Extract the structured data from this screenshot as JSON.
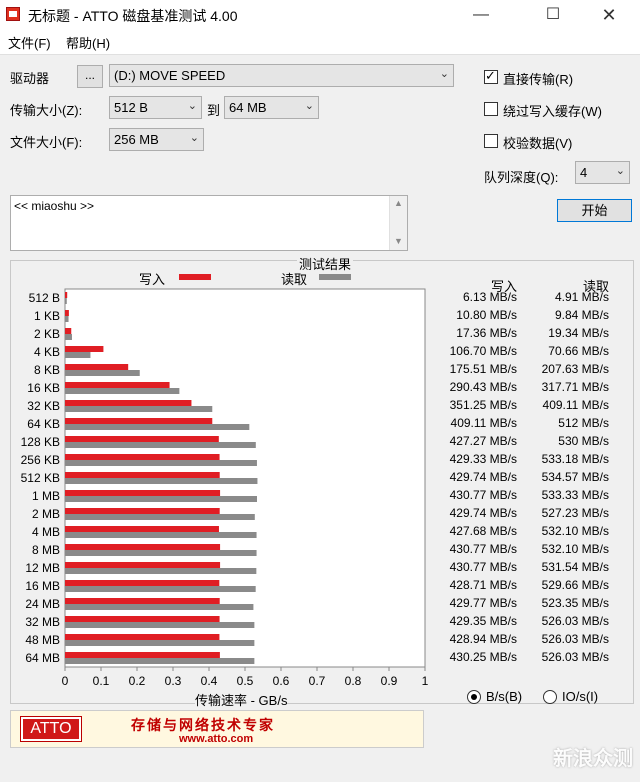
{
  "window": {
    "title": "无标题 - ATTO 磁盘基准测试 4.00"
  },
  "menu": {
    "file": "文件(F)",
    "help": "帮助(H)"
  },
  "settings": {
    "drive_label": "驱动器",
    "drive_browse": "...",
    "drive_value": "(D:) MOVE SPEED",
    "transfer_label": "传输大小(Z):",
    "transfer_from": "512 B",
    "to_label": "到",
    "transfer_to": "64 MB",
    "file_size_label": "文件大小(F):",
    "file_size": "256 MB",
    "direct_io_label": "直接传输(R)",
    "direct_io_checked": true,
    "bypass_cache_label": "绕过写入缓存(W)",
    "bypass_cache_checked": false,
    "verify_label": "校验数据(V)",
    "verify_checked": false,
    "queue_label": "队列深度(Q):",
    "queue_value": "4",
    "start_label": "开始"
  },
  "log": {
    "text": "<< miaoshu >>"
  },
  "results": {
    "title": "测试结果",
    "write_legend": "写入",
    "read_legend": "读取",
    "col_write": "写入",
    "col_read": "读取",
    "rows": [
      {
        "size": "512 B",
        "write": "6.13 MB/s",
        "read": "4.91 MB/s"
      },
      {
        "size": "1 KB",
        "write": "10.80 MB/s",
        "read": "9.84 MB/s"
      },
      {
        "size": "2 KB",
        "write": "17.36 MB/s",
        "read": "19.34 MB/s"
      },
      {
        "size": "4 KB",
        "write": "106.70 MB/s",
        "read": "70.66 MB/s"
      },
      {
        "size": "8 KB",
        "write": "175.51 MB/s",
        "read": "207.63 MB/s"
      },
      {
        "size": "16 KB",
        "write": "290.43 MB/s",
        "read": "317.71 MB/s"
      },
      {
        "size": "32 KB",
        "write": "351.25 MB/s",
        "read": "409.11 MB/s"
      },
      {
        "size": "64 KB",
        "write": "409.11 MB/s",
        "read": "512 MB/s"
      },
      {
        "size": "128 KB",
        "write": "427.27 MB/s",
        "read": "530 MB/s"
      },
      {
        "size": "256 KB",
        "write": "429.33 MB/s",
        "read": "533.18 MB/s"
      },
      {
        "size": "512 KB",
        "write": "429.74 MB/s",
        "read": "534.57 MB/s"
      },
      {
        "size": "1 MB",
        "write": "430.77 MB/s",
        "read": "533.33 MB/s"
      },
      {
        "size": "2 MB",
        "write": "429.74 MB/s",
        "read": "527.23 MB/s"
      },
      {
        "size": "4 MB",
        "write": "427.68 MB/s",
        "read": "532.10 MB/s"
      },
      {
        "size": "8 MB",
        "write": "430.77 MB/s",
        "read": "532.10 MB/s"
      },
      {
        "size": "12 MB",
        "write": "430.77 MB/s",
        "read": "531.54 MB/s"
      },
      {
        "size": "16 MB",
        "write": "428.71 MB/s",
        "read": "529.66 MB/s"
      },
      {
        "size": "24 MB",
        "write": "429.77 MB/s",
        "read": "523.35 MB/s"
      },
      {
        "size": "32 MB",
        "write": "429.35 MB/s",
        "read": "526.03 MB/s"
      },
      {
        "size": "48 MB",
        "write": "428.94 MB/s",
        "read": "526.03 MB/s"
      },
      {
        "size": "64 MB",
        "write": "430.25 MB/s",
        "read": "526.03 MB/s"
      }
    ],
    "unit_bs": "B/s(B)",
    "unit_bs_selected": true,
    "unit_ios": "IO/s(I)"
  },
  "chart_data": {
    "type": "bar",
    "orientation": "horizontal",
    "title": "测试结果",
    "xlabel": "传输速率 - GB/s",
    "xlim": [
      0,
      1
    ],
    "xticks": [
      "0",
      "0.1",
      "0.2",
      "0.3",
      "0.4",
      "0.5",
      "0.6",
      "0.7",
      "0.8",
      "0.9",
      "1"
    ],
    "categories": [
      "512 B",
      "1 KB",
      "2 KB",
      "4 KB",
      "8 KB",
      "16 KB",
      "32 KB",
      "64 KB",
      "128 KB",
      "256 KB",
      "512 KB",
      "1 MB",
      "2 MB",
      "4 MB",
      "8 MB",
      "12 MB",
      "16 MB",
      "24 MB",
      "32 MB",
      "48 MB",
      "64 MB"
    ],
    "series": [
      {
        "name": "写入",
        "color": "#e01e24",
        "values": [
          0.00613,
          0.0108,
          0.01736,
          0.1067,
          0.17551,
          0.29043,
          0.35125,
          0.40911,
          0.42727,
          0.42933,
          0.42974,
          0.43077,
          0.42974,
          0.42768,
          0.43077,
          0.43077,
          0.42871,
          0.42977,
          0.42935,
          0.42894,
          0.43025
        ]
      },
      {
        "name": "读取",
        "color": "#8a8a8a",
        "values": [
          0.00491,
          0.00984,
          0.01934,
          0.07066,
          0.20763,
          0.31771,
          0.40911,
          0.512,
          0.53,
          0.53318,
          0.53457,
          0.53333,
          0.52723,
          0.5321,
          0.5321,
          0.53154,
          0.52966,
          0.52335,
          0.52603,
          0.52603,
          0.52603
        ]
      }
    ],
    "grid": false,
    "legend": "top"
  },
  "banner": {
    "logo": "ATTO",
    "tagline": "存储与网络技术专家",
    "url": "www.atto.com"
  },
  "watermark": "新浪众测"
}
